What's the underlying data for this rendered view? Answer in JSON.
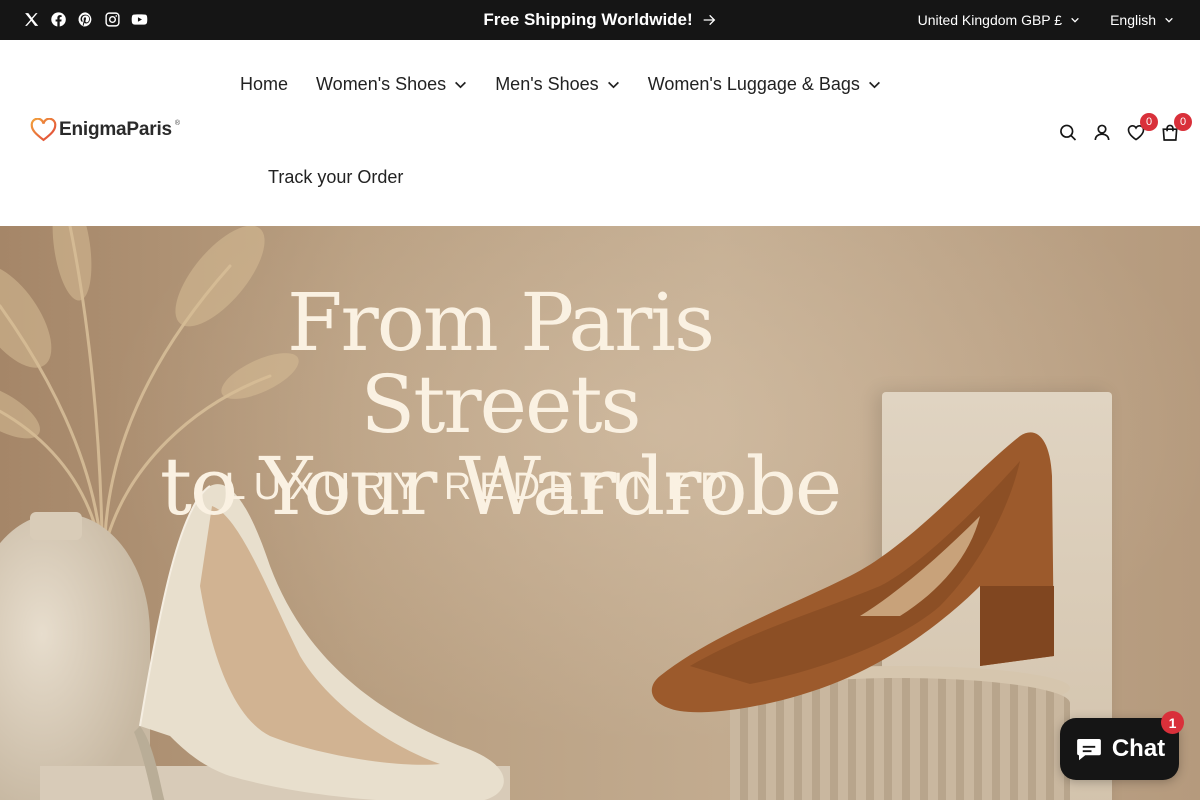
{
  "announcement": {
    "socials": [
      "x-icon",
      "facebook-icon",
      "pinterest-icon",
      "instagram-icon",
      "youtube-icon"
    ],
    "text": "Free Shipping Worldwide!",
    "country_currency": "United Kingdom GBP £",
    "language": "English"
  },
  "header": {
    "logo_text": "EnigmaParis",
    "logo_reg": "®",
    "nav": [
      {
        "label": "Home"
      },
      {
        "label": "Women's Shoes"
      },
      {
        "label": "Men's Shoes"
      },
      {
        "label": "Women's Luggage & Bags"
      },
      {
        "label": "Track your Order"
      }
    ],
    "wishlist_count": "0",
    "cart_count": "0"
  },
  "hero": {
    "title_line1": "From Paris Streets",
    "title_line2": "to Your Wardrobe",
    "subtitle": "LUXURY REDEFINED"
  },
  "chat": {
    "label": "Chat",
    "unread": "1"
  },
  "colors": {
    "topbar": "#151515",
    "badge": "#d9303a",
    "hero_text": "#faf1e2"
  }
}
